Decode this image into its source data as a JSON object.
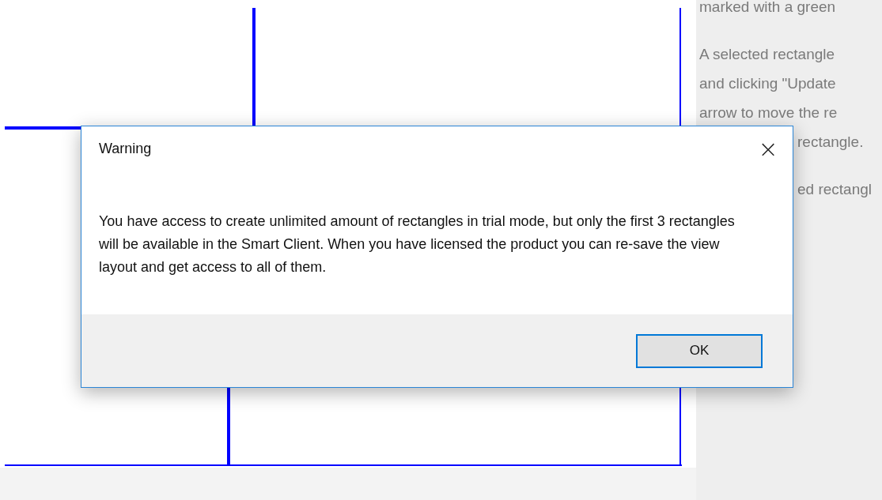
{
  "help_panel": {
    "lines": [
      {
        "text": "marked with a green",
        "covered": false
      },
      {
        "text": "A selected rectangle",
        "covered": false
      },
      {
        "text": "and clicking \"Update",
        "covered": false
      },
      {
        "text": "arrow to move the re",
        "covered": false
      },
      {
        "text": "rectangle.",
        "covered": true
      },
      {
        "text": "ed rectangl",
        "covered": true
      }
    ]
  },
  "dialog": {
    "title": "Warning",
    "close": "×",
    "message": "You have access to create unlimited amount of rectangles in trial mode, but only the first 3 rectangles will be available in the Smart Client. When you have licensed the product you can re-save the view layout and get access to all of them.",
    "buttons": [
      {
        "label": "OK",
        "selected": true
      }
    ]
  }
}
